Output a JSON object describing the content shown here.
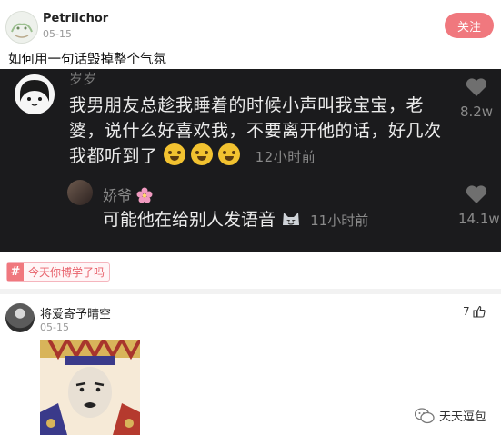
{
  "post1": {
    "username": "Petriichor",
    "date": "05-15",
    "follow_label": "关注",
    "title": "如何用一句话毁掉整个气氛"
  },
  "screenshot": {
    "top_partial_name": "岁岁",
    "comment1": {
      "text": "我男朋友总趁我睡着的时候小声叫我宝宝，老婆，说什么好喜欢我，不要离开他的话，好几次我都听到了",
      "time": "12小时前",
      "likes": "8.2w"
    },
    "comment2": {
      "name": "娇爷",
      "text": "可能他在给别人发语音",
      "time": "11小时前",
      "likes": "14.1w"
    }
  },
  "topic_tag": "今天你博学了吗",
  "post2": {
    "username": "将爱寄予晴空",
    "date": "05-15",
    "likes": "7"
  },
  "watermark": "天天逗包",
  "colors": {
    "accent": "#f0787e",
    "dark_bg": "#1b1b1d"
  }
}
